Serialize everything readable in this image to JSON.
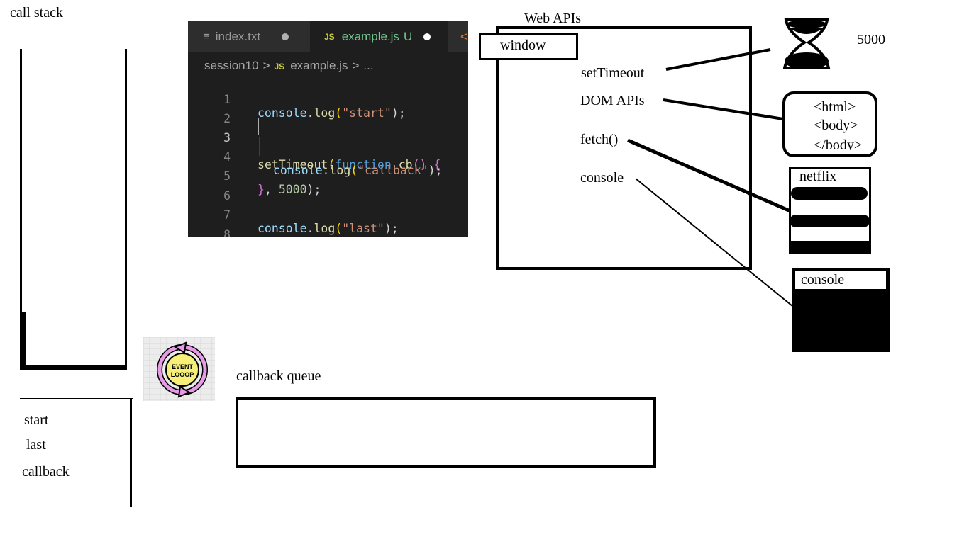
{
  "diagram": {
    "call_stack_label": "call stack",
    "web_apis_label": "Web APIs",
    "window_label": "window",
    "api_items": [
      "setTimeout",
      "DOM APIs",
      "fetch()",
      "console"
    ],
    "timer_value": "5000",
    "html_lines": [
      "<html>",
      "<body>",
      "</body>"
    ],
    "netflix_label": "netflix",
    "console_label": "console",
    "callback_queue_label": "callback queue",
    "event_loop_text": [
      "EVENT",
      "LOOOP"
    ],
    "output_lines": [
      "start",
      "last",
      "callback"
    ]
  },
  "editor": {
    "tabs": [
      {
        "label": "index.txt",
        "icon": "text-file-icon"
      },
      {
        "label": "example.js",
        "badge": "JS",
        "status": "U"
      }
    ],
    "breadcrumb": {
      "folder": "session10",
      "badge": "JS",
      "file": "example.js",
      "more": "..."
    },
    "line_numbers": [
      "1",
      "2",
      "3",
      "4",
      "5",
      "6",
      "7",
      "8"
    ],
    "code": {
      "l1": [
        "console",
        ".",
        "log",
        "(",
        "\"start\"",
        ");"
      ],
      "l3": [
        "setTimeout",
        "(",
        "function",
        " ",
        "cb",
        "()",
        " ",
        "{"
      ],
      "l4": [
        "console",
        ".",
        "log",
        "(",
        "\"callback\"",
        ");"
      ],
      "l5": [
        "}",
        ", ",
        "5000",
        ");"
      ],
      "l7": [
        "console",
        ".",
        "log",
        "(",
        "\"last\"",
        ");"
      ]
    }
  },
  "colors": {
    "event_loop_fill": "#f6f079",
    "event_loop_arrows": "#e79ae6"
  }
}
